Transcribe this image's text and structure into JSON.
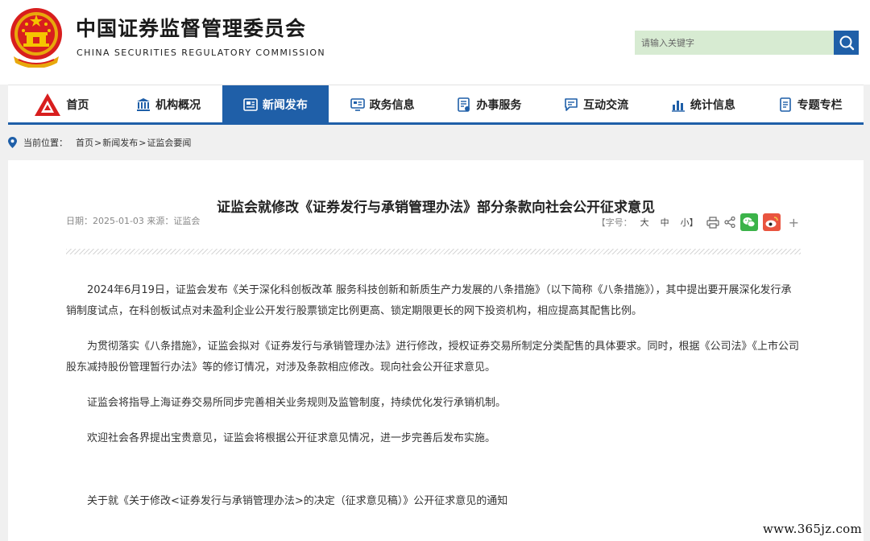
{
  "header": {
    "title_cn": "中国证券监督管理委员会",
    "title_en": "CHINA SECURITIES REGULATORY COMMISSION",
    "emblem_icon": "national-emblem-icon",
    "search": {
      "placeholder": "请输入关键字",
      "icon": "search-icon"
    }
  },
  "nav": {
    "items": [
      {
        "label": "首页",
        "icon": "home-logo-icon"
      },
      {
        "label": "机构概况",
        "icon": "building-icon"
      },
      {
        "label": "新闻发布",
        "icon": "news-icon",
        "active": true
      },
      {
        "label": "政务信息",
        "icon": "info-screen-icon"
      },
      {
        "label": "办事服务",
        "icon": "service-doc-icon"
      },
      {
        "label": "互动交流",
        "icon": "chat-icon"
      },
      {
        "label": "统计信息",
        "icon": "bar-chart-icon"
      },
      {
        "label": "专题专栏",
        "icon": "topic-doc-icon"
      }
    ],
    "accent": "#1f5fa8"
  },
  "breadcrumb": {
    "label": "当前位置：",
    "items": [
      "首页",
      "新闻发布",
      "证监会要闻"
    ],
    "separator": ">"
  },
  "article": {
    "title": "证监会就修改《证券发行与承销管理办法》部分条款向社会公开征求意见",
    "meta": "日期：2025-01-03 来源：证监会",
    "tools": {
      "font_label_open": "【字号：",
      "size_large": "大",
      "size_medium": "中",
      "size_small": "小】",
      "plus": "+"
    },
    "paragraphs": [
      "2024年6月19日，证监会发布《关于深化科创板改革 服务科技创新和新质生产力发展的八条措施》（以下简称《八条措施》），其中提出要开展深化发行承销制度试点，在科创板试点对未盈利企业公开发行股票锁定比例更高、锁定期限更长的网下投资机构，相应提高其配售比例。",
      "为贯彻落实《八条措施》，证监会拟对《证券发行与承销管理办法》进行修改，授权证券交易所制定分类配售的具体要求。同时，根据《公司法》《上市公司股东减持股份管理暂行办法》等的修订情况，对涉及条款相应修改。现向社会公开征求意见。",
      "证监会将指导上海证券交易所同步完善相关业务规则及监管制度，持续优化发行承销机制。",
      "欢迎社会各界提出宝贵意见，证监会将根据公开征求意见情况，进一步完善后发布实施。"
    ],
    "attachment_link": "关于就《关于修改<证券发行与承销管理办法>的决定（征求意见稿）》公开征求意见的通知"
  },
  "watermark": "www.365jz.com"
}
